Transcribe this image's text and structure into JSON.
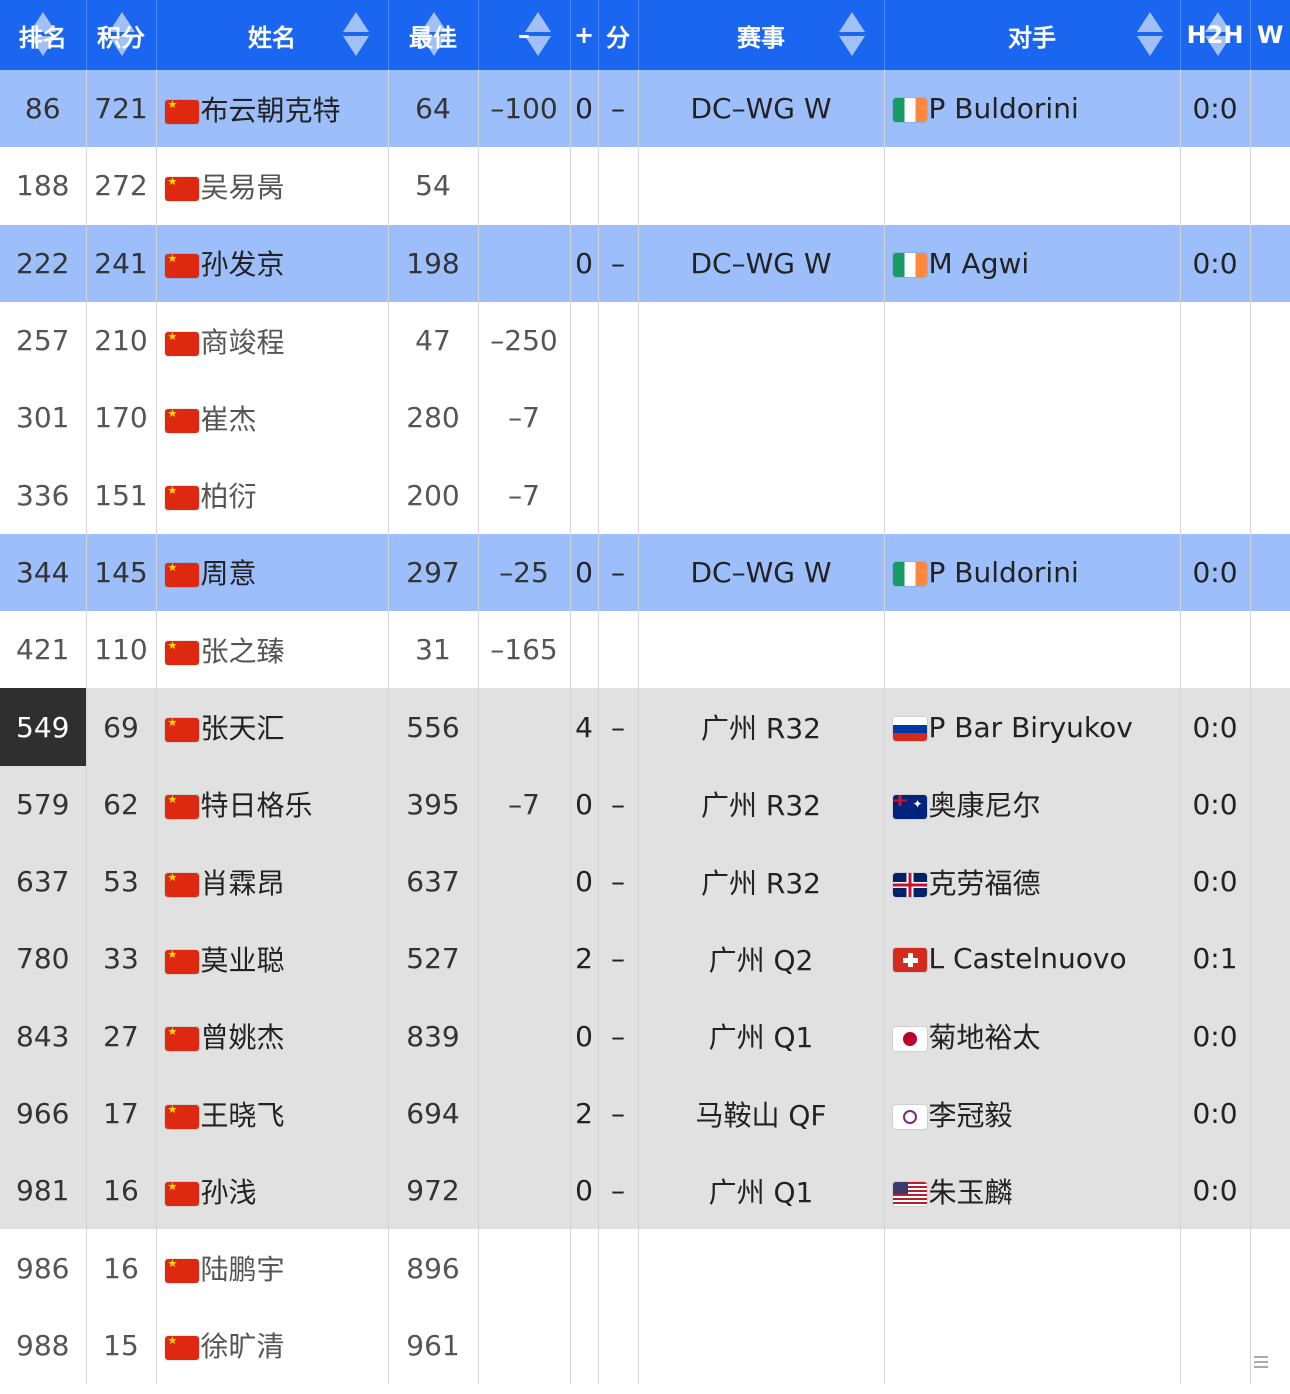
{
  "colors": {
    "header_bg": "#1a66f0",
    "highlight_row": "#9cbefb",
    "gray_row": "#e1e1e1",
    "white_row": "#ffffff",
    "current_rank_cell": "#2f2f2f"
  },
  "headers": {
    "rank": "排名",
    "points": "积分",
    "name": "姓名",
    "best": "最佳",
    "change": "–",
    "plus": "+",
    "score": "分",
    "event": "赛事",
    "opponent": "对手",
    "h2h": "H2H",
    "w": "W"
  },
  "rows": [
    {
      "rank": "86",
      "points": "721",
      "flag": "cn-flag-icon",
      "name": "布云朝克特",
      "best": "64",
      "change": "–100",
      "plus": "0",
      "score": "–",
      "event": "DC–WG W",
      "opp_flag": "ie-flag-icon",
      "opponent": "P Buldorini",
      "h2h": "0:0",
      "style": "highlight"
    },
    {
      "rank": "188",
      "points": "272",
      "flag": "cn-flag-icon",
      "name": "吴易昺",
      "best": "54",
      "change": "",
      "plus": "",
      "score": "",
      "event": "",
      "opp_flag": "",
      "opponent": "",
      "h2h": "",
      "style": "white"
    },
    {
      "rank": "222",
      "points": "241",
      "flag": "cn-flag-icon",
      "name": "孙发京",
      "best": "198",
      "change": "",
      "plus": "0",
      "score": "–",
      "event": "DC–WG W",
      "opp_flag": "ie-flag-icon",
      "opponent": "M Agwi",
      "h2h": "0:0",
      "style": "highlight"
    },
    {
      "rank": "257",
      "points": "210",
      "flag": "cn-flag-icon",
      "name": "商竣程",
      "best": "47",
      "change": "–250",
      "plus": "",
      "score": "",
      "event": "",
      "opp_flag": "",
      "opponent": "",
      "h2h": "",
      "style": "white"
    },
    {
      "rank": "301",
      "points": "170",
      "flag": "cn-flag-icon",
      "name": "崔杰",
      "best": "280",
      "change": "–7",
      "plus": "",
      "score": "",
      "event": "",
      "opp_flag": "",
      "opponent": "",
      "h2h": "",
      "style": "white"
    },
    {
      "rank": "336",
      "points": "151",
      "flag": "cn-flag-icon",
      "name": "柏衍",
      "best": "200",
      "change": "–7",
      "plus": "",
      "score": "",
      "event": "",
      "opp_flag": "",
      "opponent": "",
      "h2h": "",
      "style": "white"
    },
    {
      "rank": "344",
      "points": "145",
      "flag": "cn-flag-icon",
      "name": "周意",
      "best": "297",
      "change": "–25",
      "plus": "0",
      "score": "–",
      "event": "DC–WG W",
      "opp_flag": "ie-flag-icon",
      "opponent": "P Buldorini",
      "h2h": "0:0",
      "style": "highlight"
    },
    {
      "rank": "421",
      "points": "110",
      "flag": "cn-flag-icon",
      "name": "张之臻",
      "best": "31",
      "change": "–165",
      "plus": "",
      "score": "",
      "event": "",
      "opp_flag": "",
      "opponent": "",
      "h2h": "",
      "style": "white"
    },
    {
      "rank": "549",
      "points": "69",
      "flag": "cn-flag-icon",
      "name": "张天汇",
      "best": "556",
      "change": "",
      "plus": "4",
      "score": "–",
      "event": "广州 R32",
      "opp_flag": "ru-flag-icon",
      "opponent": "P Bar Biryukov",
      "h2h": "0:0",
      "style": "gray",
      "current": true
    },
    {
      "rank": "579",
      "points": "62",
      "flag": "cn-flag-icon",
      "name": "特日格乐",
      "best": "395",
      "change": "–7",
      "plus": "0",
      "score": "–",
      "event": "广州 R32",
      "opp_flag": "au-flag-icon",
      "opponent": "奥康尼尔",
      "h2h": "0:0",
      "style": "gray"
    },
    {
      "rank": "637",
      "points": "53",
      "flag": "cn-flag-icon",
      "name": "肖霖昂",
      "best": "637",
      "change": "",
      "plus": "0",
      "score": "–",
      "event": "广州 R32",
      "opp_flag": "gb-flag-icon",
      "opponent": "克劳福德",
      "h2h": "0:0",
      "style": "gray"
    },
    {
      "rank": "780",
      "points": "33",
      "flag": "cn-flag-icon",
      "name": "莫业聪",
      "best": "527",
      "change": "",
      "plus": "2",
      "score": "–",
      "event": "广州 Q2",
      "opp_flag": "ch-flag-icon",
      "opponent": "L Castelnuovo",
      "h2h": "0:1",
      "style": "gray"
    },
    {
      "rank": "843",
      "points": "27",
      "flag": "cn-flag-icon",
      "name": "曾姚杰",
      "best": "839",
      "change": "",
      "plus": "0",
      "score": "–",
      "event": "广州 Q1",
      "opp_flag": "jp-flag-icon",
      "opponent": "菊地裕太",
      "h2h": "0:0",
      "style": "gray"
    },
    {
      "rank": "966",
      "points": "17",
      "flag": "cn-flag-icon",
      "name": "王晓飞",
      "best": "694",
      "change": "",
      "plus": "2",
      "score": "–",
      "event": "马鞍山 QF",
      "opp_flag": "tw-flag-icon",
      "opponent": "李冠毅",
      "h2h": "0:0",
      "style": "gray"
    },
    {
      "rank": "981",
      "points": "16",
      "flag": "cn-flag-icon",
      "name": "孙浅",
      "best": "972",
      "change": "",
      "plus": "0",
      "score": "–",
      "event": "广州 Q1",
      "opp_flag": "us-flag-icon",
      "opponent": "朱玉麟",
      "h2h": "0:0",
      "style": "gray"
    },
    {
      "rank": "986",
      "points": "16",
      "flag": "cn-flag-icon",
      "name": "陆鹏宇",
      "best": "896",
      "change": "",
      "plus": "",
      "score": "",
      "event": "",
      "opp_flag": "",
      "opponent": "",
      "h2h": "",
      "style": "white"
    },
    {
      "rank": "988",
      "points": "15",
      "flag": "cn-flag-icon",
      "name": "徐旷清",
      "best": "961",
      "change": "",
      "plus": "",
      "score": "",
      "event": "",
      "opp_flag": "",
      "opponent": "",
      "h2h": "",
      "style": "white"
    }
  ]
}
